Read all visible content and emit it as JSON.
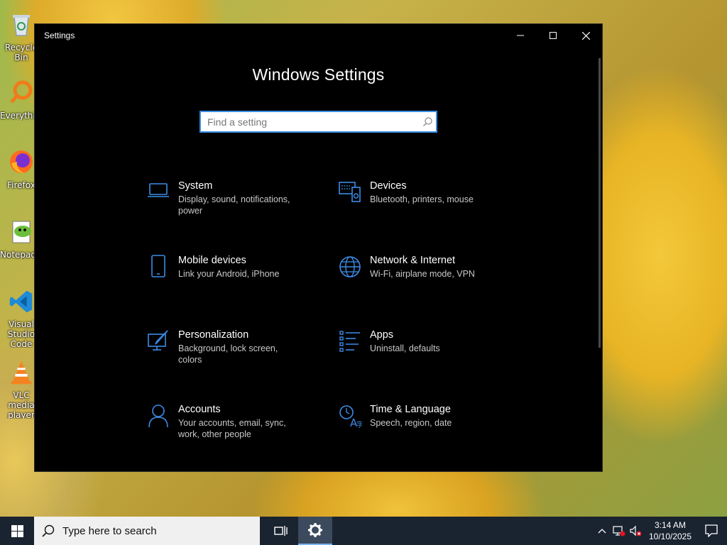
{
  "desktop": {
    "icons": [
      {
        "label": "Recycle Bin",
        "icon": "recycle-bin-icon"
      },
      {
        "label": "Everything",
        "icon": "everything-search-icon"
      },
      {
        "label": "Firefox",
        "icon": "firefox-icon"
      },
      {
        "label": "Notepad++",
        "icon": "notepad-plus-plus-icon"
      },
      {
        "label": "Visual Studio Code",
        "icon": "vscode-icon"
      },
      {
        "label": "VLC media player",
        "icon": "vlc-icon"
      }
    ]
  },
  "window": {
    "title": "Settings",
    "heading": "Windows Settings",
    "search_placeholder": "Find a setting",
    "controls": {
      "minimize": "minimize",
      "maximize": "maximize",
      "close": "close"
    }
  },
  "tiles": [
    {
      "name": "System",
      "desc": "Display, sound, notifications, power",
      "icon": "laptop-icon"
    },
    {
      "name": "Devices",
      "desc": "Bluetooth, printers, mouse",
      "icon": "devices-icon"
    },
    {
      "name": "Mobile devices",
      "desc": "Link your Android, iPhone",
      "icon": "phone-icon"
    },
    {
      "name": "Network & Internet",
      "desc": "Wi-Fi, airplane mode, VPN",
      "icon": "globe-icon"
    },
    {
      "name": "Personalization",
      "desc": "Background, lock screen, colors",
      "icon": "personalization-icon"
    },
    {
      "name": "Apps",
      "desc": "Uninstall, defaults",
      "icon": "apps-list-icon"
    },
    {
      "name": "Accounts",
      "desc": "Your accounts, email, sync, work, other people",
      "icon": "person-icon"
    },
    {
      "name": "Time & Language",
      "desc": "Speech, region, date",
      "icon": "time-language-icon"
    }
  ],
  "taskbar": {
    "search_placeholder": "Type here to search",
    "time": "3:14 AM",
    "date": "10/10/2025"
  },
  "colors": {
    "accent": "#3a8ee6",
    "tile_icon": "#3c8ce7",
    "window_bg": "#000000",
    "taskbar_bg": "#1a2330"
  }
}
